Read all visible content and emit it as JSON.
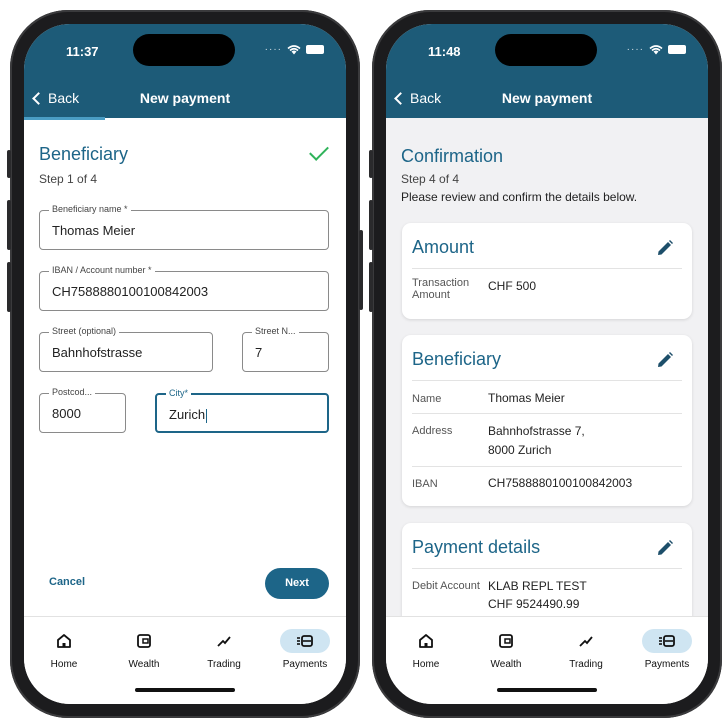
{
  "left": {
    "status_time": "11:37",
    "header": {
      "back_label": "Back",
      "title": "New payment"
    },
    "step": {
      "title": "Beneficiary",
      "subtitle": "Step 1 of 4"
    },
    "fields": {
      "beneficiary_name": {
        "label": "Beneficiary name *",
        "value": "Thomas Meier"
      },
      "iban": {
        "label": "IBAN / Account number *",
        "value": "CH7588880100100842003"
      },
      "street": {
        "label": "Street (optional)",
        "value": "Bahnhofstrasse"
      },
      "street_no": {
        "label": "Street N...",
        "value": "7"
      },
      "postcode": {
        "label": "Postcod...",
        "value": "8000"
      },
      "city": {
        "label": "City*",
        "value": "Zurich"
      }
    },
    "actions": {
      "cancel": "Cancel",
      "next": "Next"
    }
  },
  "right": {
    "status_time": "11:48",
    "header": {
      "back_label": "Back",
      "title": "New payment"
    },
    "step": {
      "title": "Confirmation",
      "subtitle": "Step 4 of 4",
      "instruction": "Please review and confirm the details below."
    },
    "amount_card": {
      "title": "Amount",
      "label": "Transaction Amount",
      "value": "CHF 500"
    },
    "beneficiary_card": {
      "title": "Beneficiary",
      "name_label": "Name",
      "name_value": "Thomas Meier",
      "address_label": "Address",
      "address_line1": "Bahnhofstrasse 7,",
      "address_line2": "8000 Zurich",
      "iban_label": "IBAN",
      "iban_value": "CH7588880100100842003"
    },
    "payment_card": {
      "title": "Payment details",
      "debit_label": "Debit Account",
      "debit_name": "KLAB REPL TEST",
      "debit_balance": "CHF 9524490.99"
    }
  },
  "tabs": [
    {
      "label": "Home",
      "icon": "home-icon"
    },
    {
      "label": "Wealth",
      "icon": "wallet-icon"
    },
    {
      "label": "Trading",
      "icon": "trend-icon"
    },
    {
      "label": "Payments",
      "icon": "payments-icon",
      "active": true
    }
  ],
  "progress": {
    "left_step_fraction": 0.25
  },
  "colors": {
    "header": "#1d5b78",
    "accent": "#1d6588",
    "check": "#2fb35a",
    "tab_active_bg": "#cfe5f2"
  }
}
